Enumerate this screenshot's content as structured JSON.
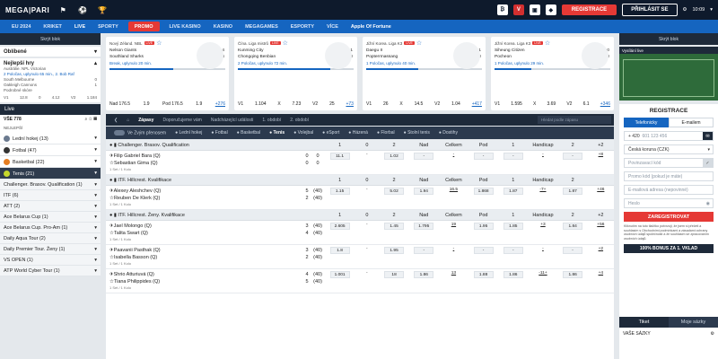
{
  "top": {
    "logo": "MEGA|PARI",
    "register": "REGISTRACE",
    "login": "PŘIHLÁSIT SE",
    "time": "10:09",
    "icons": [
      "bitcoin-icon",
      "vip-icon",
      "gift-icon",
      "shield-icon",
      "settings-icon",
      "user-icon"
    ]
  },
  "nav": {
    "items": [
      "EU 2024",
      "KRIKET",
      "LIVE",
      "SPORTY",
      "PROMO",
      "LIVE KASINO",
      "KASINO",
      "MEGAGAMES",
      "ESPORTY",
      "VÍCE",
      "Apple Of Fortune"
    ],
    "active": "LIVE"
  },
  "left": {
    "hide": "Skrýt blok",
    "fav": "Oblíbené",
    "top": "Nejlepší hry",
    "top_league": "Austrálie. NPL Victorian",
    "top_status": "2 Poločas, uplynulo 65 min., 2. Bob Raf",
    "teams": [
      "South Melbourne",
      "Oakleigh Cannons"
    ],
    "scores": [
      "0",
      "1"
    ],
    "more": "Podrobné skóre",
    "odds": [
      "V1",
      "12.8",
      "0",
      "4.12",
      "V2",
      "1.184"
    ],
    "live": "Live",
    "all": "VŠE 778",
    "popular": "NEJLEPŠÍ",
    "sports": [
      {
        "name": "Lední hokej (13)",
        "color": "#6b7a8f"
      },
      {
        "name": "Fotbal (47)",
        "color": "#333333"
      },
      {
        "name": "Basketbal (22)",
        "color": "#e67e22"
      },
      {
        "name": "Tenis (21)",
        "color": "#c6d82c"
      }
    ],
    "subs": [
      "Challenger. Brasov. Qualification (1)",
      "ITF (6)",
      "ATT (2)",
      "Ace Belarus Cup (1)",
      "Ace Belarus Cup. Pro-Am (1)",
      "Daily Aqua Tour (2)",
      "Daily Premier Tour. Ženy (1)",
      "VS OPEN (1)",
      "ATP World Cyber Tour (1)"
    ]
  },
  "cards": [
    {
      "league": "Nový Zéland. NBL",
      "teams": [
        "Nelson Giants",
        "Southland Sharks"
      ],
      "score1": "36 14 24",
      "score2": "24 16 26",
      "status": "Break, uplynulo 20 min.",
      "progress": 0.55,
      "odds": [
        "Nad 176.5",
        "1.9",
        "Pod 176.5",
        "1.9",
        "+276"
      ]
    },
    {
      "league": "Čína. Liga mistrů",
      "teams": [
        "Kunming City",
        "Chongqing Benbian"
      ],
      "score1": "0 0 1",
      "score2": "0 0 0",
      "status": "2 Poločas, uplynulo 72 min.",
      "progress": 0.8,
      "odds": [
        "V1",
        "1.104",
        "X",
        "7.23",
        "V2",
        "25",
        "+73"
      ]
    },
    {
      "league": "Jižní Korea. Liga K3",
      "teams": [
        "Daegu II",
        "Popterrmassang"
      ],
      "score1": "1",
      "score2": "0",
      "status": "1 Poločas, uplynulo 40 min.",
      "progress": 0.45,
      "odds": [
        "V1",
        "26",
        "X",
        "14.5",
        "V2",
        "1.04",
        "+417"
      ]
    },
    {
      "league": "Jižní Korea. Liga K3",
      "teams": [
        "Siheung Citizen",
        "Pocheon"
      ],
      "score1": "0",
      "score2": "0",
      "status": "1 Poločas, uplynulo 29 min.",
      "progress": 0.32,
      "odds": [
        "V1",
        "1.595",
        "X",
        "3.69",
        "V2",
        "6.1",
        "+346"
      ]
    }
  ],
  "tabs": [
    "Zápasy",
    "Doporučujeme vám",
    "Nadcházející události",
    "1. období",
    "2. období"
  ],
  "search": "Hledat podle zápasu",
  "sports_bar": [
    "Ve Zvým přenosem",
    "Lední hokej",
    "Fotbal",
    "Basketbal",
    "Tenis",
    "Volejbal",
    "eSport",
    "Házená",
    "Florbal",
    "Stolní tenis",
    "Dostihy"
  ],
  "headers": [
    "1",
    "0",
    "2",
    "Nad",
    "Celkem",
    "Pod",
    "1",
    "Handicap",
    "2",
    "+"
  ],
  "leagues": [
    {
      "name": "Challenger. Brasov. Qualification",
      "extra": "+2",
      "matches": [
        {
          "p": [
            "Filip Gabriel Bara (Q)",
            "Sebastian Gima (Q)"
          ],
          "s1": [
            "0",
            "0"
          ],
          "s2": [
            "0",
            "0"
          ],
          "meta": "1 Set / 1 Kolo",
          "odds": [
            "11.1",
            "-",
            "1.02",
            "-",
            "-",
            "-",
            "-",
            "-",
            "-",
            "+8"
          ]
        }
      ]
    },
    {
      "name": "ITF. Hillcrest. Kvalifikace",
      "extra": "",
      "matches": [
        {
          "p": [
            "Alexey Aleshchev (Q)",
            "Reuben De Klerk (Q)"
          ],
          "s1": [
            "5",
            "2"
          ],
          "s2": [
            "(40)",
            "(40)"
          ],
          "meta": "1 Set / 1 Kolo",
          "odds": [
            "1.15",
            "-",
            "5.02",
            "1.94",
            "16.5",
            "1.868",
            "1.87",
            "-7+",
            "1.87",
            "+46"
          ]
        }
      ]
    },
    {
      "name": "ITF. Hillcrest. Ženy. Kvalifikace",
      "extra": "+2",
      "matches": [
        {
          "p": [
            "Jael Molongo (Q)",
            "Talita Swart (Q)"
          ],
          "s1": [
            "3",
            "4"
          ],
          "s2": [
            "(40)",
            "(40)"
          ],
          "meta": "1 Set / 1 Kolo",
          "odds": [
            "2.605",
            "-",
            "1.45",
            "1.795",
            "19",
            "1.95",
            "1.85",
            "+3",
            "1.84",
            "+56"
          ]
        },
        {
          "p": [
            "Paavanii Pasthak (Q)",
            "Isabella Basson (Q)"
          ],
          "s1": [
            "3",
            "2"
          ],
          "s2": [
            "(40)",
            "(40)"
          ],
          "meta": "1 Set / 1 Kolo",
          "odds": [
            "1.8",
            "-",
            "1.95",
            "-",
            "-",
            "-",
            "-",
            "-",
            "-",
            "+2"
          ]
        },
        {
          "p": [
            "Shrio Atturiuvá (Q)",
            "Tiana Philippides (Q)"
          ],
          "s1": [
            "4",
            "5"
          ],
          "s2": [
            "(40)",
            "(40)"
          ],
          "meta": "1 Set / 1 Kolo",
          "odds": [
            "1.001",
            "-",
            "18",
            "1.86",
            "13",
            "1.88",
            "1.86",
            "-11+",
            "1.86",
            "+4"
          ]
        }
      ]
    }
  ],
  "right": {
    "hide": "Skrýt blok",
    "video": "Vysílání live",
    "reg_title": "REGISTRACE",
    "reg_tabs": [
      "Telefonicky",
      "E-mailem"
    ],
    "phone_prefix": "+ 420",
    "phone_ph": "601 123 456",
    "currency": "Česká koruna (CZK)",
    "promo_ph": "Povinzavací kód",
    "promo2_ph": "Promo kód (pokud je máte)",
    "email_ph": "E-mailová adresa (nepovinné)",
    "pass_ph": "Heslo",
    "reg_btn": "ZAREGISTROVAT",
    "legal": "Kliknutím na tuto tlačítko potvrzuji, že jsem si přečetl a souhlasím s Obchodními podmínkami a zásadami ochrany osobních údajů společnosti a že souhlasím se zpracováním osobních údajů.",
    "bonus": "100% BONUS ZA 1. VKLAD",
    "ticket_tabs": [
      "Tiket",
      "Moje sázky"
    ],
    "ticket_label": "VAŠE SÁZKY"
  }
}
